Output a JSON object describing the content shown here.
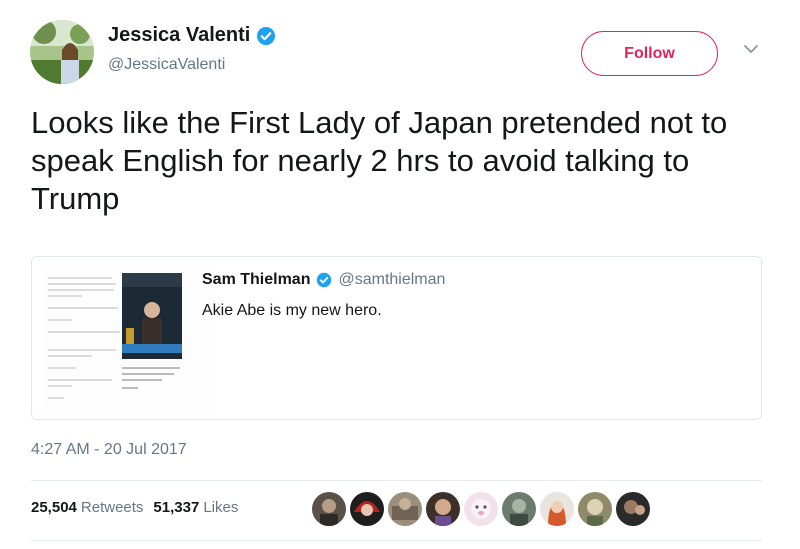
{
  "author": {
    "display_name": "Jessica Valenti",
    "handle": "@JessicaValenti",
    "verified": true
  },
  "actions": {
    "follow_label": "Follow"
  },
  "tweet": {
    "text": "Looks like the First Lady of Japan pretended not to speak English for nearly 2 hrs to avoid talking to Trump",
    "timestamp": "4:27 AM - 20 Jul 2017"
  },
  "quote": {
    "display_name": "Sam Thielman",
    "handle": "@samthielman",
    "verified": true,
    "text": "Akie Abe is my new hero."
  },
  "stats": {
    "retweets_count": "25,504",
    "retweets_label": "Retweets",
    "likes_count": "51,337",
    "likes_label": "Likes"
  },
  "colors": {
    "accent": "#e0245e",
    "verified": "#1da1f2",
    "secondary_text": "#657786",
    "border": "#e1e8ed"
  }
}
